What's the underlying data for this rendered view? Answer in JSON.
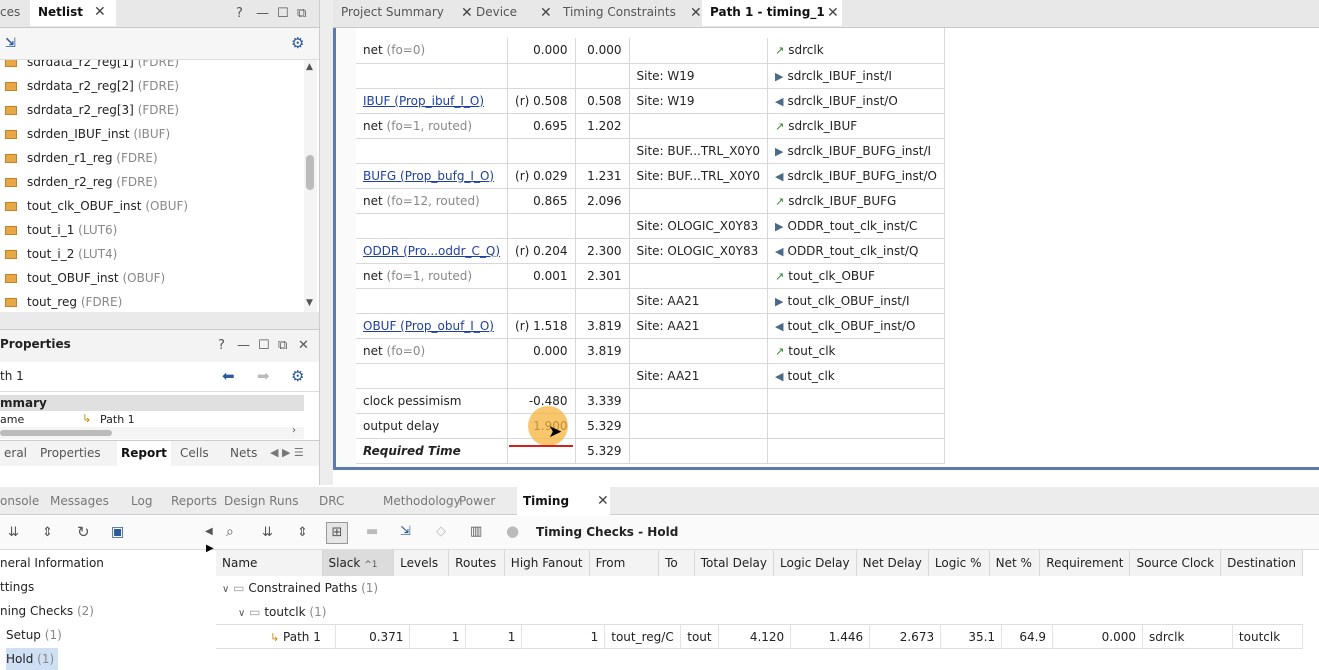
{
  "netlist_panel": {
    "tab_left": "ces",
    "tab_active": "Netlist",
    "items": [
      {
        "name": "sdrdata_r2_reg[1]",
        "type": "(FDRE)"
      },
      {
        "name": "sdrdata_r2_reg[2]",
        "type": "(FDRE)"
      },
      {
        "name": "sdrdata_r2_reg[3]",
        "type": "(FDRE)"
      },
      {
        "name": "sdrden_IBUF_inst",
        "type": "(IBUF)"
      },
      {
        "name": "sdrden_r1_reg",
        "type": "(FDRE)"
      },
      {
        "name": "sdrden_r2_reg",
        "type": "(FDRE)"
      },
      {
        "name": "tout_clk_OBUF_inst",
        "type": "(OBUF)"
      },
      {
        "name": "tout_i_1",
        "type": "(LUT6)"
      },
      {
        "name": "tout_i_2",
        "type": "(LUT4)"
      },
      {
        "name": "tout_OBUF_inst",
        "type": "(OBUF)"
      },
      {
        "name": "tout_reg",
        "type": "(FDRE)"
      }
    ]
  },
  "properties_panel": {
    "title": "Properties",
    "object": "th 1",
    "section": "mmary",
    "name_label": "ame",
    "name_value": "Path 1",
    "tabs": [
      "eral",
      "Properties",
      "Report",
      "Cells",
      "Nets"
    ],
    "active_tab": "Report"
  },
  "editor_tabs": [
    {
      "label": "Project Summary",
      "active": false
    },
    {
      "label": "Device",
      "active": false
    },
    {
      "label": "Timing Constraints",
      "active": false
    },
    {
      "label": "Path 1 - timing_1",
      "active": true
    }
  ],
  "report_rows": [
    {
      "c1": "net",
      "c1_note": "(fo=0)",
      "link": false,
      "bold": false,
      "c2": "0.000",
      "c3": "0.000",
      "site": "",
      "icon": "net",
      "c5": "sdrclk"
    },
    {
      "c1": "",
      "c1_note": "",
      "link": false,
      "bold": false,
      "c2": "",
      "c3": "",
      "site": "Site: W19",
      "icon": "pin-in",
      "c5": "sdrclk_IBUF_inst/I"
    },
    {
      "c1": "IBUF (Prop_ibuf_I_O)",
      "c1_note": "",
      "link": true,
      "bold": false,
      "c2": "(r) 0.508",
      "c3": "0.508",
      "site": "Site: W19",
      "icon": "pin-out",
      "c5": "sdrclk_IBUF_inst/O"
    },
    {
      "c1": "net",
      "c1_note": "(fo=1, routed)",
      "link": false,
      "bold": false,
      "c2": "0.695",
      "c3": "1.202",
      "site": "",
      "icon": "net",
      "c5": "sdrclk_IBUF"
    },
    {
      "c1": "",
      "c1_note": "",
      "link": false,
      "bold": false,
      "c2": "",
      "c3": "",
      "site": "Site: BUF...TRL_X0Y0",
      "icon": "pin-in",
      "c5": "sdrclk_IBUF_BUFG_inst/I"
    },
    {
      "c1": "BUFG (Prop_bufg_I_O)",
      "c1_note": "",
      "link": true,
      "bold": false,
      "c2": "(r) 0.029",
      "c3": "1.231",
      "site": "Site: BUF...TRL_X0Y0",
      "icon": "pin-out",
      "c5": "sdrclk_IBUF_BUFG_inst/O"
    },
    {
      "c1": "net",
      "c1_note": "(fo=12, routed)",
      "link": false,
      "bold": false,
      "c2": "0.865",
      "c3": "2.096",
      "site": "",
      "icon": "net",
      "c5": "sdrclk_IBUF_BUFG"
    },
    {
      "c1": "",
      "c1_note": "",
      "link": false,
      "bold": false,
      "c2": "",
      "c3": "",
      "site": "Site: OLOGIC_X0Y83",
      "icon": "pin-in",
      "c5": "ODDR_tout_clk_inst/C"
    },
    {
      "c1": "ODDR (Pro...oddr_C_Q)",
      "c1_note": "",
      "link": true,
      "bold": false,
      "c2": "(r) 0.204",
      "c3": "2.300",
      "site": "Site: OLOGIC_X0Y83",
      "icon": "pin-out",
      "c5": "ODDR_tout_clk_inst/Q"
    },
    {
      "c1": "net",
      "c1_note": "(fo=1, routed)",
      "link": false,
      "bold": false,
      "c2": "0.001",
      "c3": "2.301",
      "site": "",
      "icon": "net",
      "c5": "tout_clk_OBUF"
    },
    {
      "c1": "",
      "c1_note": "",
      "link": false,
      "bold": false,
      "c2": "",
      "c3": "",
      "site": "Site: AA21",
      "icon": "pin-in",
      "c5": "tout_clk_OBUF_inst/I"
    },
    {
      "c1": "OBUF (Prop_obuf_I_O)",
      "c1_note": "",
      "link": true,
      "bold": false,
      "c2": "(r) 1.518",
      "c3": "3.819",
      "site": "Site: AA21",
      "icon": "pin-out",
      "c5": "tout_clk_OBUF_inst/O"
    },
    {
      "c1": "net",
      "c1_note": "(fo=0)",
      "link": false,
      "bold": false,
      "c2": "0.000",
      "c3": "3.819",
      "site": "",
      "icon": "net",
      "c5": "tout_clk"
    },
    {
      "c1": "",
      "c1_note": "",
      "link": false,
      "bold": false,
      "c2": "",
      "c3": "",
      "site": "Site: AA21",
      "icon": "pin-out",
      "c5": "tout_clk"
    },
    {
      "c1": "clock pessimism",
      "c1_note": "",
      "link": false,
      "bold": false,
      "c2": "-0.480",
      "c3": "3.339",
      "site": "",
      "icon": "",
      "c5": ""
    },
    {
      "c1": "output delay",
      "c1_note": "",
      "link": false,
      "bold": false,
      "c2": "1.900",
      "c3": "5.329",
      "site": "",
      "icon": "",
      "c5": "",
      "highlight": true
    },
    {
      "c1": "Required Time",
      "c1_note": "",
      "link": false,
      "bold": true,
      "c2": "",
      "c3": "5.329",
      "site": "",
      "icon": "",
      "c5": ""
    }
  ],
  "bottom_tabs": [
    {
      "label": "onsole",
      "active": false
    },
    {
      "label": "Messages",
      "active": false
    },
    {
      "label": "Log",
      "active": false
    },
    {
      "label": "Reports",
      "active": false
    },
    {
      "label": "Design Runs",
      "active": false
    },
    {
      "label": "DRC",
      "active": false
    },
    {
      "label": "Methodology",
      "active": false
    },
    {
      "label": "Power",
      "active": false
    },
    {
      "label": "Timing",
      "active": true
    }
  ],
  "timing": {
    "title": "Timing Checks - Hold",
    "tree": [
      {
        "label": "neral Information",
        "count": ""
      },
      {
        "label": "ttings",
        "count": ""
      },
      {
        "label": "ning Checks",
        "count": "(2)"
      },
      {
        "label": "Setup",
        "count": "(1)"
      },
      {
        "label": "Hold",
        "count": "(1)"
      }
    ],
    "columns": [
      "Name",
      "Slack",
      "Levels",
      "Routes",
      "High Fanout",
      "From",
      "To",
      "Total Delay",
      "Logic Delay",
      "Net Delay",
      "Logic %",
      "Net %",
      "Requirement",
      "Source Clock",
      "Destination"
    ],
    "sort_indicator": "^1",
    "group1": {
      "label": "Constrained Paths",
      "count": "(1)"
    },
    "group2": {
      "label": "toutclk",
      "count": "(1)"
    },
    "path_row": [
      "Path 1",
      "0.371",
      "1",
      "1",
      "1",
      "tout_reg/C",
      "tout",
      "4.120",
      "1.446",
      "2.673",
      "35.1",
      "64.9",
      "0.000",
      "sdrclk",
      "toutclk"
    ]
  }
}
